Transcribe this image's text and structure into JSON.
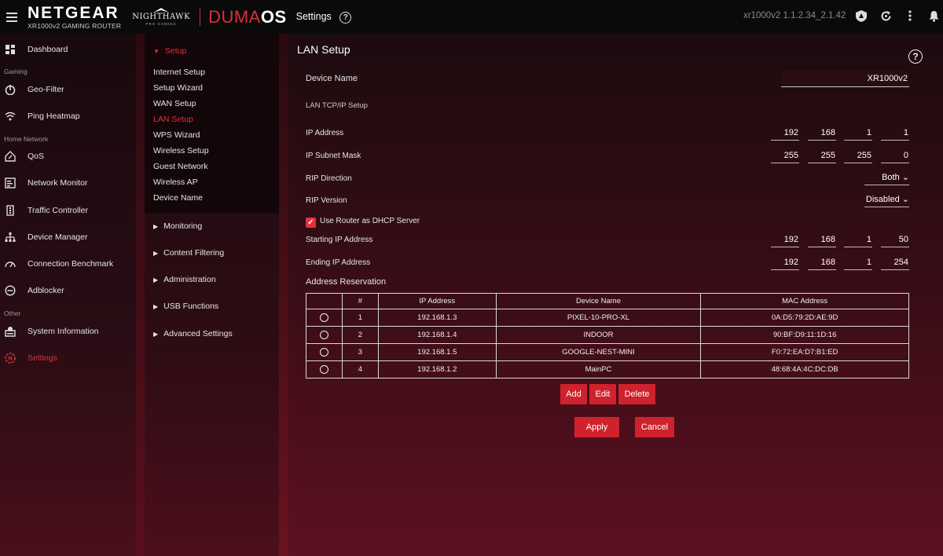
{
  "header": {
    "brand": "NETGEAR",
    "model": "XR1000v2 GAMING ROUTER",
    "nighthawk": "NIGHTHAWK",
    "nighthawk_sub": "PRO GAMING",
    "duma_prefix": "DUMA",
    "duma_suffix": "OS",
    "section": "Settings",
    "help": "?",
    "version": "xr1000v2 1.1.2.34_2.1.42"
  },
  "nav": {
    "dashboard": "Dashboard",
    "section_gaming": "Gaming",
    "geo_filter": "Geo-Filter",
    "ping_heatmap": "Ping Heatmap",
    "section_home": "Home Network",
    "qos": "QoS",
    "network_monitor": "Network Monitor",
    "traffic_controller": "Traffic Controller",
    "device_manager": "Device Manager",
    "connection_benchmark": "Connection Benchmark",
    "adblocker": "Adblocker",
    "section_other": "Other",
    "system_information": "System Information",
    "settings": "Settings"
  },
  "subnav": {
    "setup": "Setup",
    "items": [
      "Internet Setup",
      "Setup Wizard",
      "WAN Setup",
      "LAN Setup",
      "WPS Wizard",
      "Wireless Setup",
      "Guest Network",
      "Wireless AP",
      "Device Name"
    ],
    "monitoring": "Monitoring",
    "content_filtering": "Content Filtering",
    "administration": "Administration",
    "usb_functions": "USB Functions",
    "advanced_settings": "Advanced Settings"
  },
  "main": {
    "title": "LAN Setup",
    "help": "?",
    "device_name_label": "Device Name",
    "device_name_value": "XR1000v2",
    "lan_section": "LAN TCP/IP Setup",
    "ip_label": "IP Address",
    "ip": [
      "192",
      "168",
      "1",
      "1"
    ],
    "subnet_label": "IP Subnet Mask",
    "subnet": [
      "255",
      "255",
      "255",
      "0"
    ],
    "rip_direction_label": "RIP Direction",
    "rip_direction_value": "Both",
    "rip_version_label": "RIP Version",
    "rip_version_value": "Disabled",
    "dhcp_label": "Use Router as DHCP Server",
    "dhcp_checked": true,
    "start_ip_label": "Starting IP Address",
    "start_ip": [
      "192",
      "168",
      "1",
      "50"
    ],
    "end_ip_label": "Ending IP Address",
    "end_ip": [
      "192",
      "168",
      "1",
      "254"
    ],
    "reservation_title": "Address Reservation",
    "table": {
      "headers": [
        "",
        "#",
        "IP Address",
        "Device Name",
        "MAC Address"
      ],
      "rows": [
        [
          "1",
          "192.168.1.3",
          "PIXEL-10-PRO-XL",
          "0A:D5:79:2D:AE:9D"
        ],
        [
          "2",
          "192.168.1.4",
          "INDOOR",
          "90:BF:D9:11:1D:16"
        ],
        [
          "3",
          "192.168.1.5",
          "GOOGLE-NEST-MINI",
          "F0:72:EA:D7:B1:ED"
        ],
        [
          "4",
          "192.168.1.2",
          "MainPC",
          "48:68:4A:4C:DC:DB"
        ]
      ]
    },
    "add": "Add",
    "edit": "Edit",
    "delete": "Delete",
    "apply": "Apply",
    "cancel": "Cancel"
  },
  "colors": {
    "accent": "#e0323c",
    "button": "#cf222c"
  }
}
